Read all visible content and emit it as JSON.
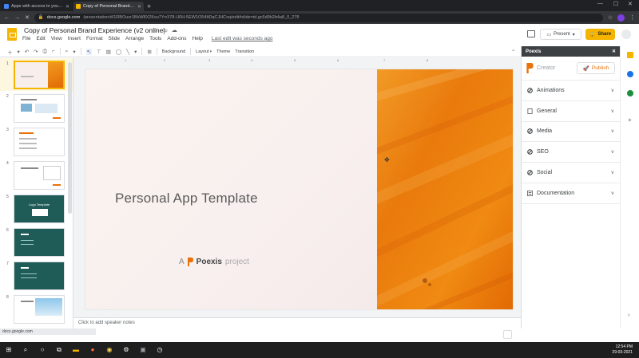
{
  "browser": {
    "tabs": [
      {
        "title": "Apps with access to your acco",
        "active": false,
        "color": "#4285f4"
      },
      {
        "title": "Copy of Personal Brand Experi",
        "active": true,
        "color": "#f4b400"
      }
    ],
    "new_tab": "+",
    "url_host": "docs.google.com",
    "url_path": "/presentation/d/1RBOuzr1BkW8X2Ksu7Yrr378-U0H-5EW1O54ItDqCJHCxq/edit#slide=id.gc6d9b2b4a8_0_278"
  },
  "doc": {
    "title": "Copy of Personal Brand Experience (v2 online)",
    "menu": [
      "File",
      "Edit",
      "View",
      "Insert",
      "Format",
      "Slide",
      "Arrange",
      "Tools",
      "Add-ons",
      "Help"
    ],
    "last_edit": "Last edit was seconds ago",
    "present_label": "Present",
    "share_label": "Share"
  },
  "toolbar": {
    "background": "Background",
    "layout": "Layout",
    "theme": "Theme",
    "transition": "Transition"
  },
  "filmstrip": {
    "numbers": [
      "1",
      "2",
      "3",
      "4",
      "5",
      "6",
      "7",
      "8"
    ],
    "slide5_title": "Logo Template"
  },
  "slide": {
    "title": "Personal App Template",
    "credit_prefix": "A",
    "credit_brand": "Poexis",
    "credit_suffix": "project"
  },
  "notes": {
    "placeholder": "Click to add speaker notes"
  },
  "ruler": [
    "1",
    "2",
    "3",
    "4",
    "5",
    "6",
    "7",
    "8"
  ],
  "panel": {
    "title": "Poexis",
    "creator_label": "Creator",
    "publish_label": "Publish",
    "sections": [
      "Animations",
      "General",
      "Media",
      "SEO",
      "Social",
      "Documentation"
    ]
  },
  "statusbar": "docs.google.com",
  "clock": {
    "time": "12:54 PM",
    "date": "29-03-2021"
  },
  "colors": {
    "accent": "#f4b400",
    "brand_orange": "#e8710a"
  }
}
